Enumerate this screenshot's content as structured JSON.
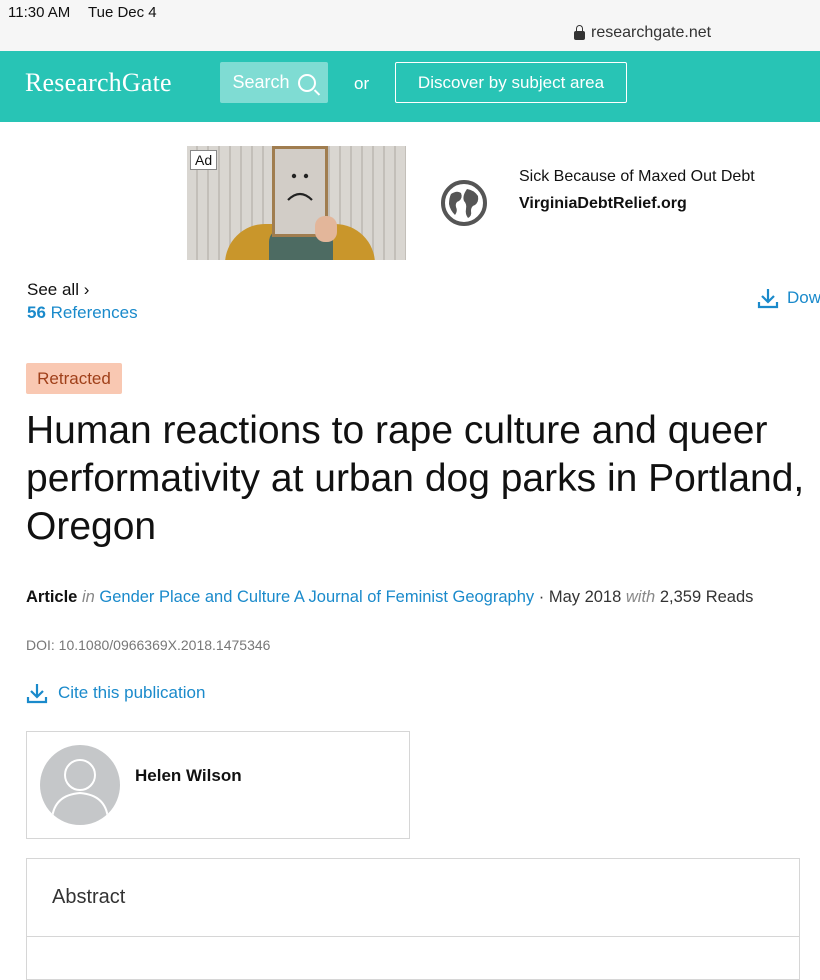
{
  "status_bar": {
    "time": "11:30 AM",
    "date": "Tue Dec 4",
    "url": "researchgate.net"
  },
  "header": {
    "logo": "ResearchGate",
    "search_label": "Search",
    "or_text": "or",
    "discover_label": "Discover by subject area"
  },
  "ad": {
    "badge": "Ad",
    "headline": "Sick Because of Maxed Out Debt",
    "domain": "VirginiaDebtRelief.org",
    "icon": "globe-icon"
  },
  "references": {
    "see_all": "See all ›",
    "count": "56",
    "label": "References"
  },
  "download": {
    "label": "Dow"
  },
  "article": {
    "status_badge": "Retracted",
    "title": "Human reactions to rape culture and queer performativity at urban dog parks in Portland, Oregon",
    "type": "Article",
    "in_word": "in",
    "journal": "Gender Place and Culture A Journal of Feminist Geography",
    "date": "May 2018",
    "with_word": "with",
    "reads": "2,359 Reads",
    "doi": "DOI: 10.1080/0966369X.2018.1475346",
    "cite_label": "Cite this publication"
  },
  "author": {
    "name": "Helen Wilson"
  },
  "abstract": {
    "heading": "Abstract"
  },
  "colors": {
    "brand": "#28c4b5",
    "link": "#1a8acb",
    "retracted_bg": "#f9c8b2"
  }
}
